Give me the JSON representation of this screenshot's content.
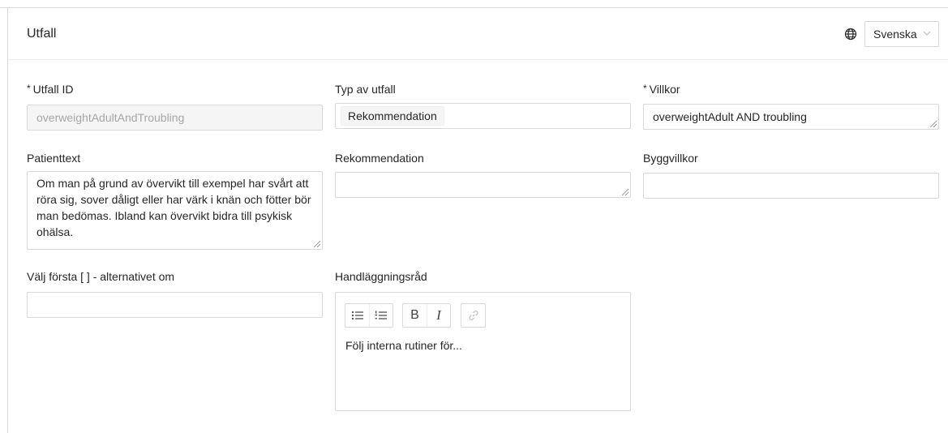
{
  "header": {
    "title": "Utfall",
    "language": "Svenska"
  },
  "fields": {
    "outcome_id": {
      "label": "Utfall ID",
      "value": "overweightAdultAndTroubling"
    },
    "outcome_type": {
      "label": "Typ av utfall",
      "value": "Rekommendation"
    },
    "conditions": {
      "label": "Villkor",
      "value": "overweightAdult AND troubling"
    },
    "patient_text": {
      "label": "Patienttext",
      "value": "Om man på grund av övervikt till exempel har svårt att röra sig, sover dåligt eller har värk i knän och fötter bör man bedömas. Ibland kan övervikt bidra till psykisk ohälsa."
    },
    "recommendation": {
      "label": "Rekommendation",
      "value": ""
    },
    "build_conditions": {
      "label": "Byggvillkor",
      "value": ""
    },
    "choose_first": {
      "label": "Välj första [ ] - alternativet om",
      "value": ""
    },
    "handling_advice": {
      "label": "Handläggningsråd",
      "value": "Följ interna rutiner för..."
    }
  },
  "required_marker": "*",
  "toolbar": {
    "bold": "B",
    "italic": "I"
  },
  "icons": {
    "globe": "globe-icon",
    "chevron": "chevron-down-icon",
    "bullet_list": "bullet-list-icon",
    "ordered_list": "ordered-list-icon",
    "link": "link-icon"
  }
}
